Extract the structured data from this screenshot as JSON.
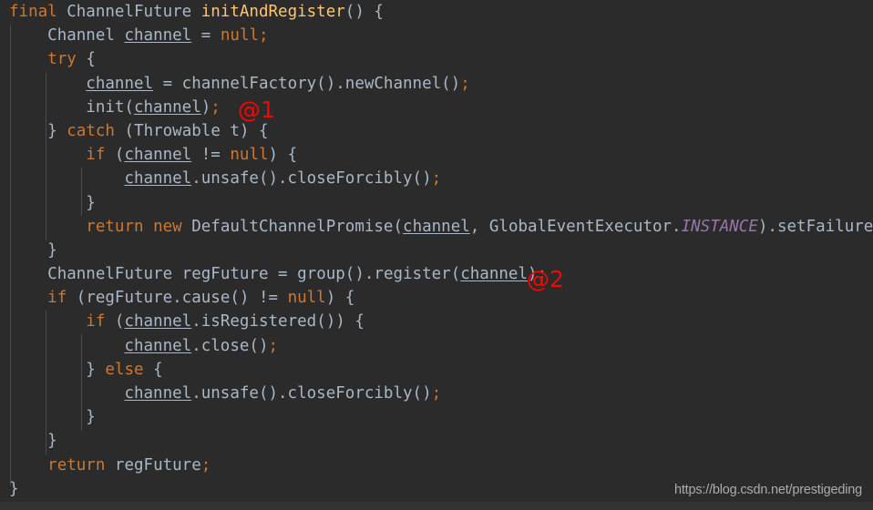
{
  "editor": {
    "theme": "darcula",
    "background_color": "#2b2b2b",
    "default_text_color": "#a9b7c6",
    "keyword_color": "#cc7832",
    "method_name_color": "#ffc66d",
    "static_field_color": "#9876aa",
    "annotation_color": "#ff0000",
    "indent_guide_color": "#4b4b4b",
    "language": "java"
  },
  "code": {
    "lines": [
      "final ChannelFuture initAndRegister() {",
      "    Channel channel = null;",
      "    try {",
      "        channel = channelFactory().newChannel();",
      "        init(channel);",
      "    } catch (Throwable t) {",
      "        if (channel != null) {",
      "            channel.unsafe().closeForcibly();",
      "        }",
      "        return new DefaultChannelPromise(channel, GlobalEventExecutor.INSTANCE).setFailure(t);",
      "    }",
      "    ChannelFuture regFuture = group().register(channel);",
      "    if (regFuture.cause() != null) {",
      "        if (channel.isRegistered()) {",
      "            channel.close();",
      "        } else {",
      "            channel.unsafe().closeForcibly();",
      "        }",
      "    }",
      "    return regFuture;",
      "}"
    ]
  },
  "annotations": [
    {
      "label": "@1",
      "line": 5,
      "note": "marks init(channel) call"
    },
    {
      "label": "@2",
      "line": 12,
      "note": "marks group().register(channel) call"
    }
  ],
  "watermark": {
    "text": "https://blog.csdn.net/prestigeding"
  }
}
